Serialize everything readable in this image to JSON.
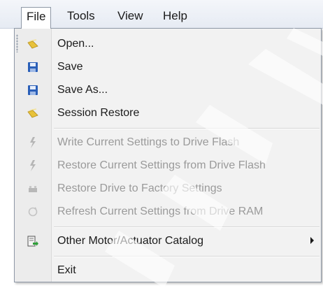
{
  "menubar": {
    "items": [
      {
        "label": "File",
        "active": true
      },
      {
        "label": "Tools",
        "active": false
      },
      {
        "label": "View",
        "active": false
      },
      {
        "label": "Help",
        "active": false
      }
    ]
  },
  "file_menu": {
    "items": [
      {
        "label": "Open...",
        "icon": "folder-icon",
        "enabled": true
      },
      {
        "label": "Save",
        "icon": "floppy-disk-icon",
        "enabled": true
      },
      {
        "label": "Save As...",
        "icon": "floppy-disk-icon",
        "enabled": true
      },
      {
        "label": "Session Restore",
        "icon": "folder-icon",
        "enabled": true
      },
      {
        "label": "Write Current Settings to Drive Flash",
        "icon": "lightning-icon",
        "enabled": false
      },
      {
        "label": "Restore Current Settings from Drive Flash",
        "icon": "lightning-icon",
        "enabled": false
      },
      {
        "label": "Restore Drive to Factory Settings",
        "icon": "factory-icon",
        "enabled": false
      },
      {
        "label": "Refresh Current Settings from Drive RAM",
        "icon": "refresh-icon",
        "enabled": false
      },
      {
        "label": "Other Motor/Actuator Catalog",
        "icon": "catalog-export-icon",
        "enabled": true,
        "has_submenu": true
      },
      {
        "label": "Exit",
        "icon": "",
        "enabled": true
      }
    ]
  },
  "colors": {
    "disabled_text": "#9a9a9a",
    "enabled_text": "#1b1b1b",
    "folder_yellow": "#e8c23a",
    "disk_blue": "#2a5fb8"
  }
}
